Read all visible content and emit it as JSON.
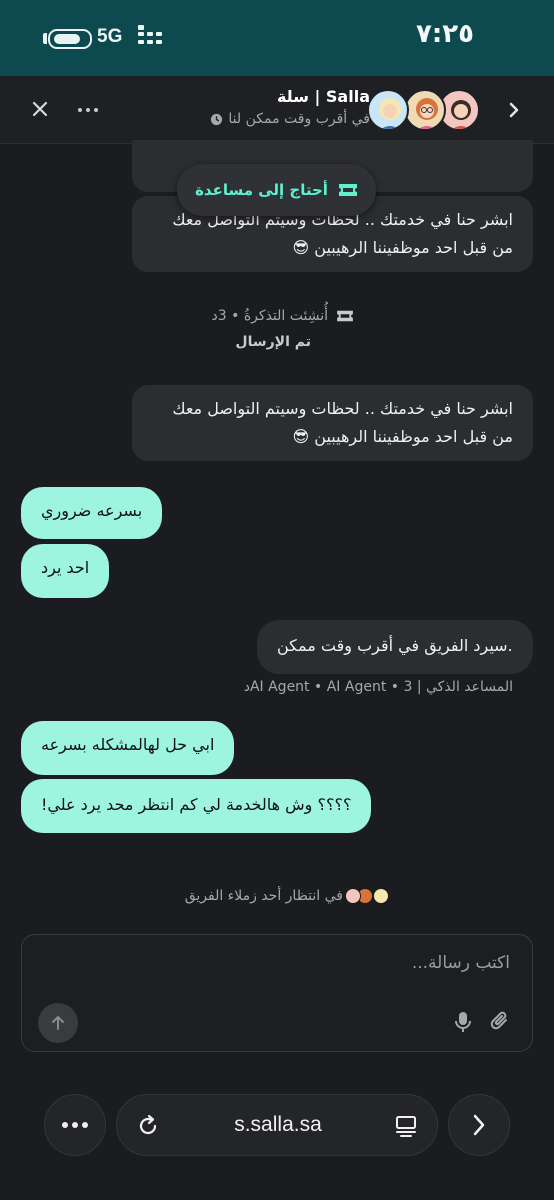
{
  "status_bar": {
    "time": "٧:٢٥",
    "network": "5G"
  },
  "header": {
    "title": "Salla | سلة",
    "subtitle": "في أقرب وقت ممكن لنا"
  },
  "help_pill": {
    "label": "أحتاج إلى مساعدة"
  },
  "messages": {
    "bot_1": {
      "line1": "ابشر حنا في خدمتك .. لحظات وسيتم التواصل معك",
      "line2": "من قبل احد موظفيننا الرهيبين 😎"
    },
    "ticket_meta": "أُنشِئت التذكرةُ • 3د",
    "ticket_sent": "تم الإرسال",
    "bot_2": {
      "line1": "ابشر حنا في خدمتك .. لحظات وسيتم التواصل معك",
      "line2": "من قبل احد موظفيننا الرهيبين 😎"
    },
    "user_1": "بسرعه ضروري",
    "user_2": "احد يرد",
    "bot_3": ".سيرد الفريق في أقرب وقت ممكن",
    "bot_3_meta": "المساعد الذكي | AI Agent • AI Agent • 3د",
    "user_3": "ابي حل لهالمشكله بسرعه",
    "user_4": "؟؟؟؟ وش هالخدمة لي كم انتظر محد يرد علي!",
    "waiting": "في انتظار أحد زملاء الفريق"
  },
  "composer": {
    "placeholder": "اكتب رسالة..."
  },
  "browser": {
    "url": "s.salla.sa"
  }
}
